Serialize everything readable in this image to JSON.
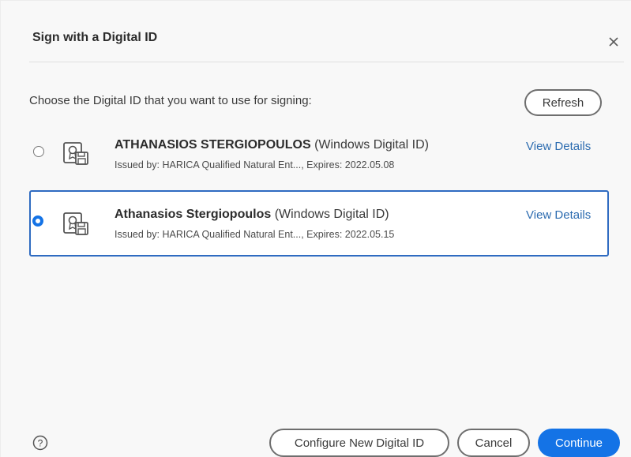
{
  "dialog": {
    "title": "Sign with a Digital ID",
    "prompt": "Choose the Digital ID that you want to use for signing:",
    "refresh_label": "Refresh"
  },
  "ids": [
    {
      "name": "ATHANASIOS STERGIOPOULOS",
      "type": "(Windows Digital ID)",
      "issued": "Issued by: HARICA Qualified Natural Ent..., Expires: 2022.05.08",
      "details_label": "View Details",
      "selected": false
    },
    {
      "name": "Athanasios Stergiopoulos",
      "type": "(Windows Digital ID)",
      "issued": "Issued by: HARICA Qualified Natural Ent..., Expires: 2022.05.15",
      "details_label": "View Details",
      "selected": true
    }
  ],
  "footer": {
    "configure_label": "Configure New Digital ID",
    "cancel_label": "Cancel",
    "continue_label": "Continue"
  },
  "icons": {
    "close": "close-icon",
    "certificate": "certificate-icon",
    "help": "help-icon"
  },
  "colors": {
    "accent": "#1473e6",
    "selected_border": "#2f6bc1",
    "link": "#2d6cb0"
  }
}
